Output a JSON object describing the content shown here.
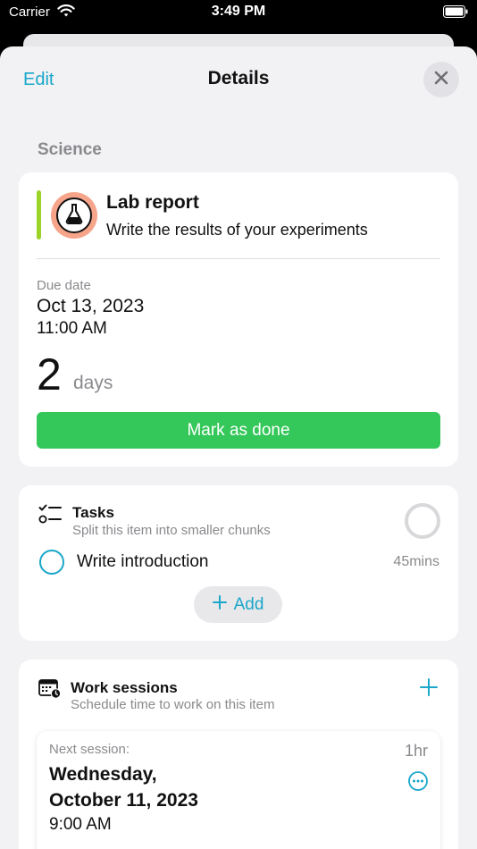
{
  "status_bar": {
    "carrier": "Carrier",
    "time": "3:49 PM"
  },
  "nav": {
    "edit_label": "Edit",
    "title": "Details"
  },
  "section": {
    "subject": "Science"
  },
  "item": {
    "title": "Lab report",
    "description": "Write the results of your experiments",
    "accent_color": "#9bd327",
    "badge_color": "#f6a48a",
    "icon": "flask-icon"
  },
  "due": {
    "label": "Due date",
    "date": "Oct 13, 2023",
    "time": "11:00 AM",
    "days_count": "2",
    "days_unit": "days"
  },
  "actions": {
    "mark_done_label": "Mark as done",
    "done_color": "#34c759"
  },
  "tasks": {
    "title": "Tasks",
    "subtitle": "Split this item into smaller chunks",
    "progress": 0,
    "items": [
      {
        "label": "Write introduction",
        "duration": "45mins",
        "done": false
      }
    ],
    "add_label": "Add"
  },
  "sessions": {
    "title": "Work sessions",
    "subtitle": "Schedule time to work on this item",
    "next": {
      "label": "Next session:",
      "date": "Wednesday,\nOctober 11, 2023",
      "time": "9:00 AM",
      "duration": "1hr"
    }
  },
  "colors": {
    "accent": "#1aa7c9",
    "muted_text": "#8a8a8e",
    "background": "#f2f2f4"
  }
}
